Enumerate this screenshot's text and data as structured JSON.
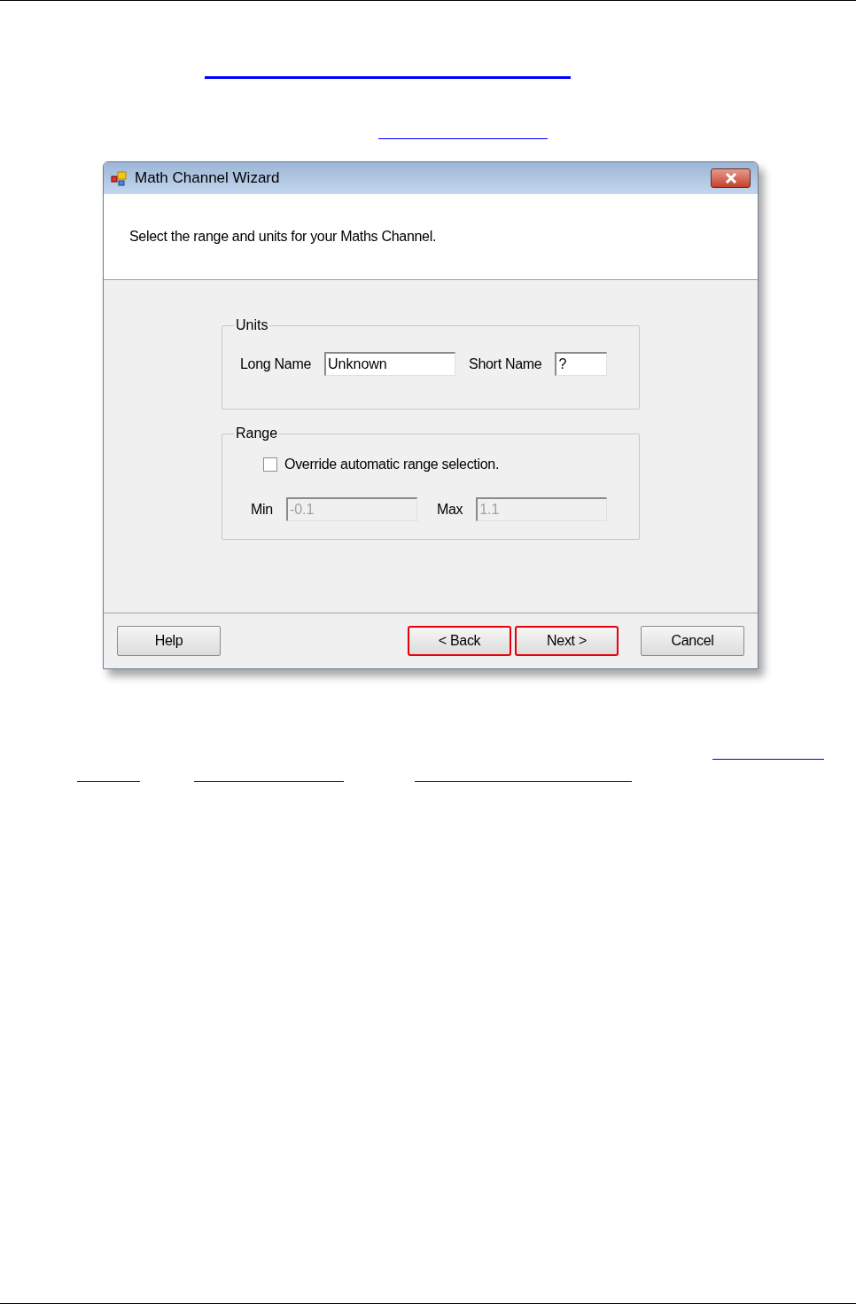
{
  "window": {
    "title": "Math Channel Wizard"
  },
  "instruction": "Select the range and units for your Maths Channel.",
  "units": {
    "title": "Units",
    "fields": [
      {
        "label": "Long Name",
        "value": "Unknown"
      },
      {
        "label": "Short Name",
        "value": "?"
      }
    ]
  },
  "range": {
    "title": "Range",
    "override": {
      "label": "Override automatic range selection.",
      "checked": false
    },
    "fields": [
      {
        "label": "Min",
        "value": "-0.1",
        "disabled": true
      },
      {
        "label": "Max",
        "value": "1.1",
        "disabled": true
      }
    ]
  },
  "buttons": [
    {
      "label": "Help",
      "highlighted": false
    },
    {
      "label": "< Back",
      "highlighted": true
    },
    {
      "label": "Next >",
      "highlighted": true
    },
    {
      "label": "Cancel",
      "highlighted": false
    }
  ]
}
